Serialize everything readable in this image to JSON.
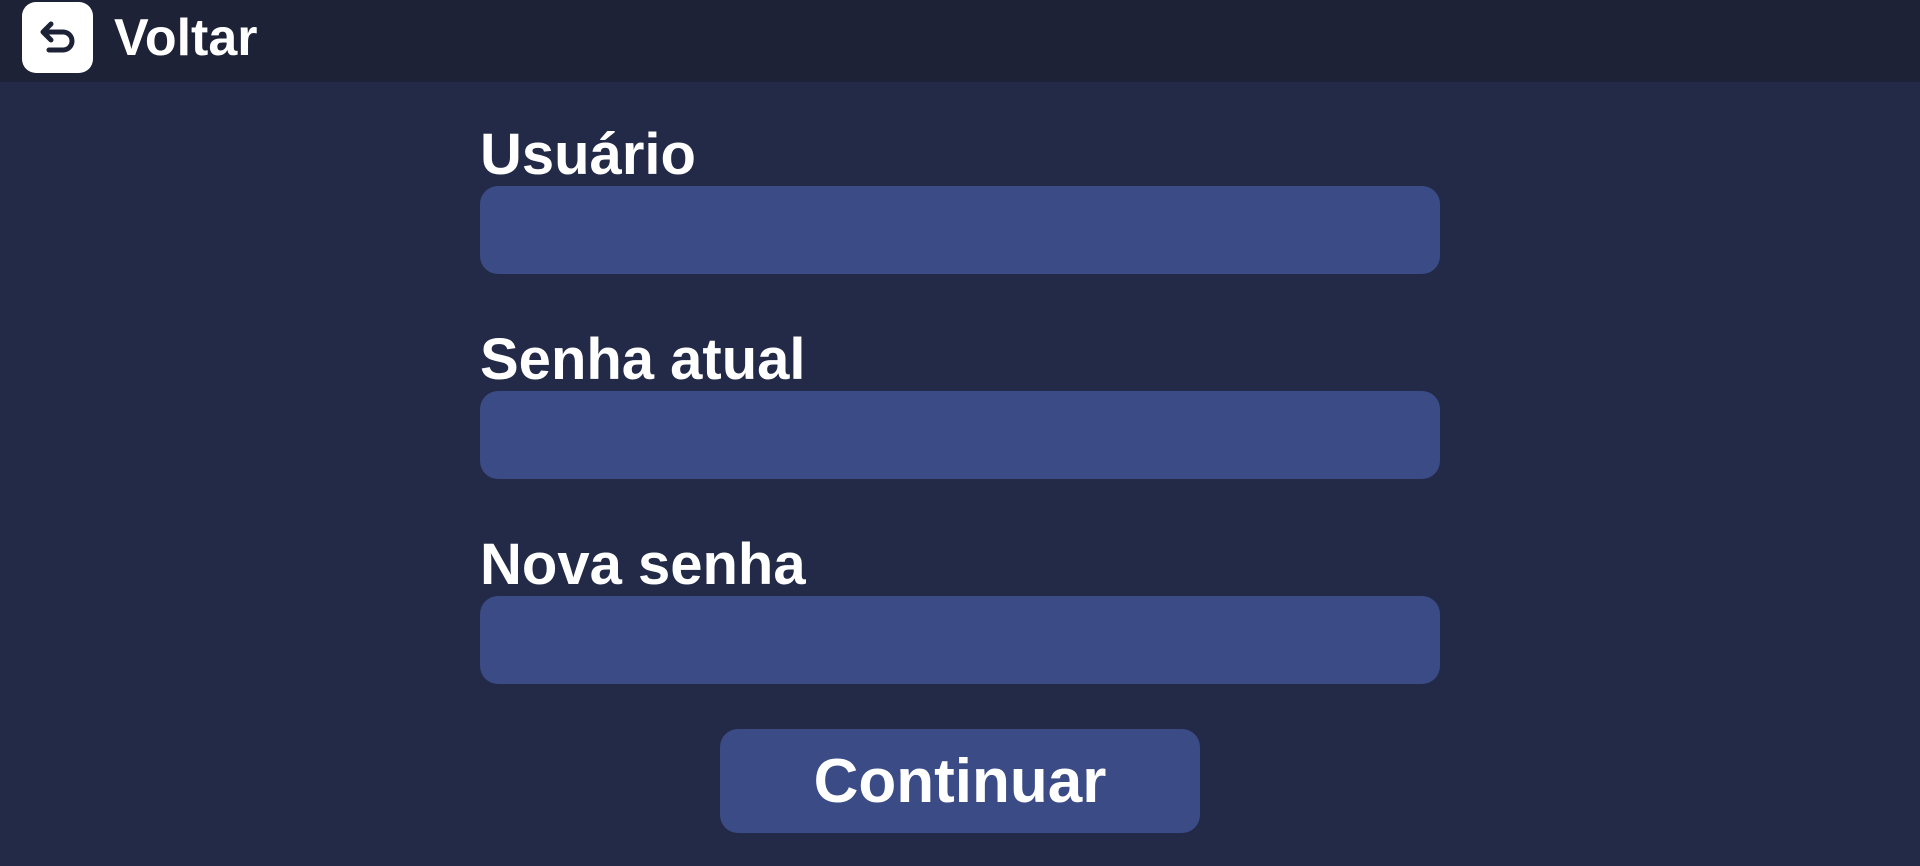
{
  "header": {
    "back_icon": "undo-arrow-icon",
    "back_label": "Voltar"
  },
  "form": {
    "fields": [
      {
        "label": "Usuário",
        "value": "",
        "placeholder": ""
      },
      {
        "label": "Senha atual",
        "value": "",
        "placeholder": ""
      },
      {
        "label": "Nova senha",
        "value": "",
        "placeholder": ""
      }
    ],
    "submit_label": "Continuar"
  },
  "colors": {
    "background": "#222a47",
    "topbar": "#1e2236",
    "input": "#3a4b86",
    "button": "#3a4b86",
    "text": "#ffffff"
  }
}
